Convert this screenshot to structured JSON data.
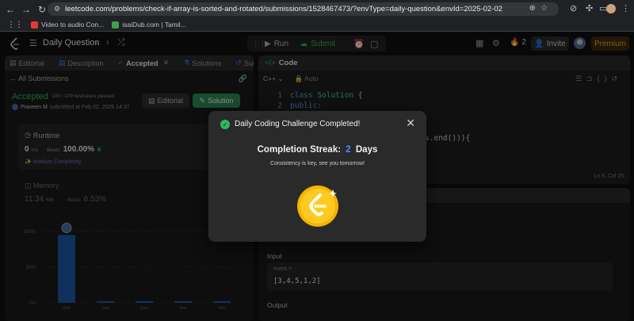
{
  "browser": {
    "url": "leetcode.com/problems/check-if-array-is-sorted-and-rotated/submissions/1528467473/?envType=daily-question&envId=2025-02-02",
    "bookmarks": [
      {
        "label": "Video to audio Con...",
        "color": "#e53935"
      },
      {
        "label": "isaiDub.com | Tamil...",
        "color": "#43a047"
      }
    ]
  },
  "nav": {
    "title": "Daily Question",
    "run_label": "Run",
    "submit_label": "Submit",
    "streak_count": "2",
    "invite_label": "Invite",
    "premium_label": "Premium"
  },
  "left": {
    "tabs": [
      {
        "label": "Editorial"
      },
      {
        "label": "Description"
      },
      {
        "label": "Accepted"
      },
      {
        "label": "Solutions"
      },
      {
        "label": "Submissions"
      }
    ],
    "all_submissions": "All Submissions",
    "status": "Accepted",
    "testcases": "109 / 109 testcases passed",
    "user": "Praveen M",
    "submitted_at": "submitted at Feb 02, 2025 14:37",
    "editorial_btn": "Editorial",
    "solution_btn": "Solution",
    "runtime": {
      "label": "Runtime",
      "value": "0",
      "unit": "ms",
      "beats_label": "Beats",
      "beats_value": "100.00%",
      "analyze": "Analyze Complexity"
    },
    "memory": {
      "label": "Memory",
      "value": "11.34",
      "unit": "MB",
      "beats_label": "Beats",
      "beats_value": "6.53%"
    }
  },
  "chart_data": {
    "type": "bar",
    "categories": [
      "0ms",
      "1ms",
      "2ms",
      "3ms",
      "4ms"
    ],
    "values": [
      95,
      1.5,
      1.5,
      1.5,
      1.5
    ],
    "yticks": [
      "100%",
      "50%",
      "0%"
    ],
    "ylim": [
      0,
      120
    ],
    "highlight_index": 0,
    "colors": {
      "bar": "#1e5aa8"
    }
  },
  "code": {
    "header": "Code",
    "language": "C++",
    "mode": "Auto",
    "lines": [
      {
        "n": "1",
        "parts": [
          {
            "t": "class ",
            "c": "kw"
          },
          {
            "t": "Solution",
            "c": "ty"
          },
          {
            "t": " {",
            "c": "tx"
          }
        ]
      },
      {
        "n": "2",
        "parts": [
          {
            "t": "public:",
            "c": "kw"
          }
        ]
      },
      {
        "n": "",
        "parts": [
          {
            "t": "ms) {",
            "c": "tx"
          }
        ]
      },
      {
        "n": "",
        "parts": [
          {
            "t": "n(),nums.end())){",
            "c": "tx"
          }
        ]
      }
    ],
    "cursor": "Ln 8, Col 25"
  },
  "testcase": {
    "input_label": "Input",
    "var_name": "nums =",
    "value": "[3,4,5,1,2]",
    "output_label": "Output"
  },
  "modal": {
    "title": "Daily Coding Challenge Completed!",
    "streak_prefix": "Completion Streak:",
    "streak_num": "2",
    "streak_suffix": "Days",
    "subtitle": "Consistency is key, see you tomorrow!"
  }
}
